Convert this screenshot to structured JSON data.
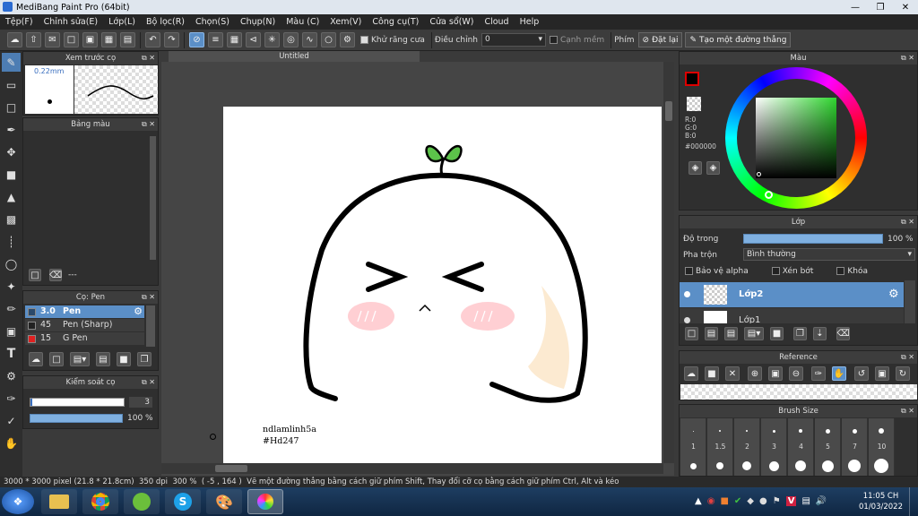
{
  "window": {
    "title": "MediBang Paint Pro (64bit)"
  },
  "menu": [
    "Tệp(F)",
    "Chỉnh sửa(E)",
    "Lớp(L)",
    "Bộ lọc(R)",
    "Chọn(S)",
    "Chụp(N)",
    "Màu (C)",
    "Xem(V)",
    "Công cụ(T)",
    "Cửa sổ(W)",
    "Cloud",
    "Help"
  ],
  "toolbar": {
    "antialias_label": "Khử răng cưa",
    "adjust_label": "Điều chỉnh",
    "adjust_value": "0",
    "edge_label": "Cạnh mềm",
    "key_label": "Phím",
    "reset_label": "Đặt lại",
    "straight_label": "Tạo một đường thẳng"
  },
  "preview_panel": {
    "title": "Xem trước cọ",
    "size": "0.22mm"
  },
  "palette_panel": {
    "title": "Bảng màu",
    "footer": "---"
  },
  "brush_panel": {
    "title": "Cọ: Pen",
    "items": [
      {
        "size": "3.0",
        "name": "Pen",
        "color": "#2b4a6b",
        "selected": true
      },
      {
        "size": "45",
        "name": "Pen (Sharp)",
        "color": "#222222",
        "selected": false
      },
      {
        "size": "15",
        "name": "G Pen",
        "color": "#e02020",
        "selected": false
      }
    ]
  },
  "control_panel": {
    "title": "Kiểm soát cọ",
    "size_value": "3",
    "opacity_value": "100 %",
    "opacity_fraction": 1.0
  },
  "canvas": {
    "tab": "Untitled",
    "signature_line1": "ndlamlinh5a",
    "signature_line2": "#Hd247"
  },
  "color_panel": {
    "title": "Màu",
    "r": "R:0",
    "g": "G:0",
    "b": "B:0",
    "hex": "#000000",
    "primary": "#000000"
  },
  "layer_panel": {
    "title": "Lớp",
    "opacity_label": "Độ trong",
    "opacity_value": "100 %",
    "blend_label": "Pha trộn",
    "blend_value": "Bình thường",
    "protect_alpha": "Bảo vệ alpha",
    "clip": "Xén bớt",
    "lock": "Khóa",
    "layers": [
      {
        "name": "Lớp2",
        "selected": true
      },
      {
        "name": "Lớp1",
        "selected": false
      }
    ]
  },
  "reference_panel": {
    "title": "Reference"
  },
  "brushsize_panel": {
    "title": "Brush Size",
    "sizes": [
      "1",
      "1.5",
      "2",
      "3",
      "4",
      "5",
      "7",
      "10"
    ]
  },
  "status": {
    "dims": "3000 * 3000 pixel",
    "cm": "(21.8 * 21.8cm)",
    "dpi": "350 dpi",
    "zoom": "300 %",
    "coords": "( -5 , 164 )",
    "hint": "Vẽ một đường thẳng bằng cách giữ phím Shift, Thay đổi cỡ cọ bằng cách giữ phím Ctrl, Alt và kéo"
  },
  "taskbar": {
    "time": "11:05 CH",
    "date": "01/03/2022"
  }
}
